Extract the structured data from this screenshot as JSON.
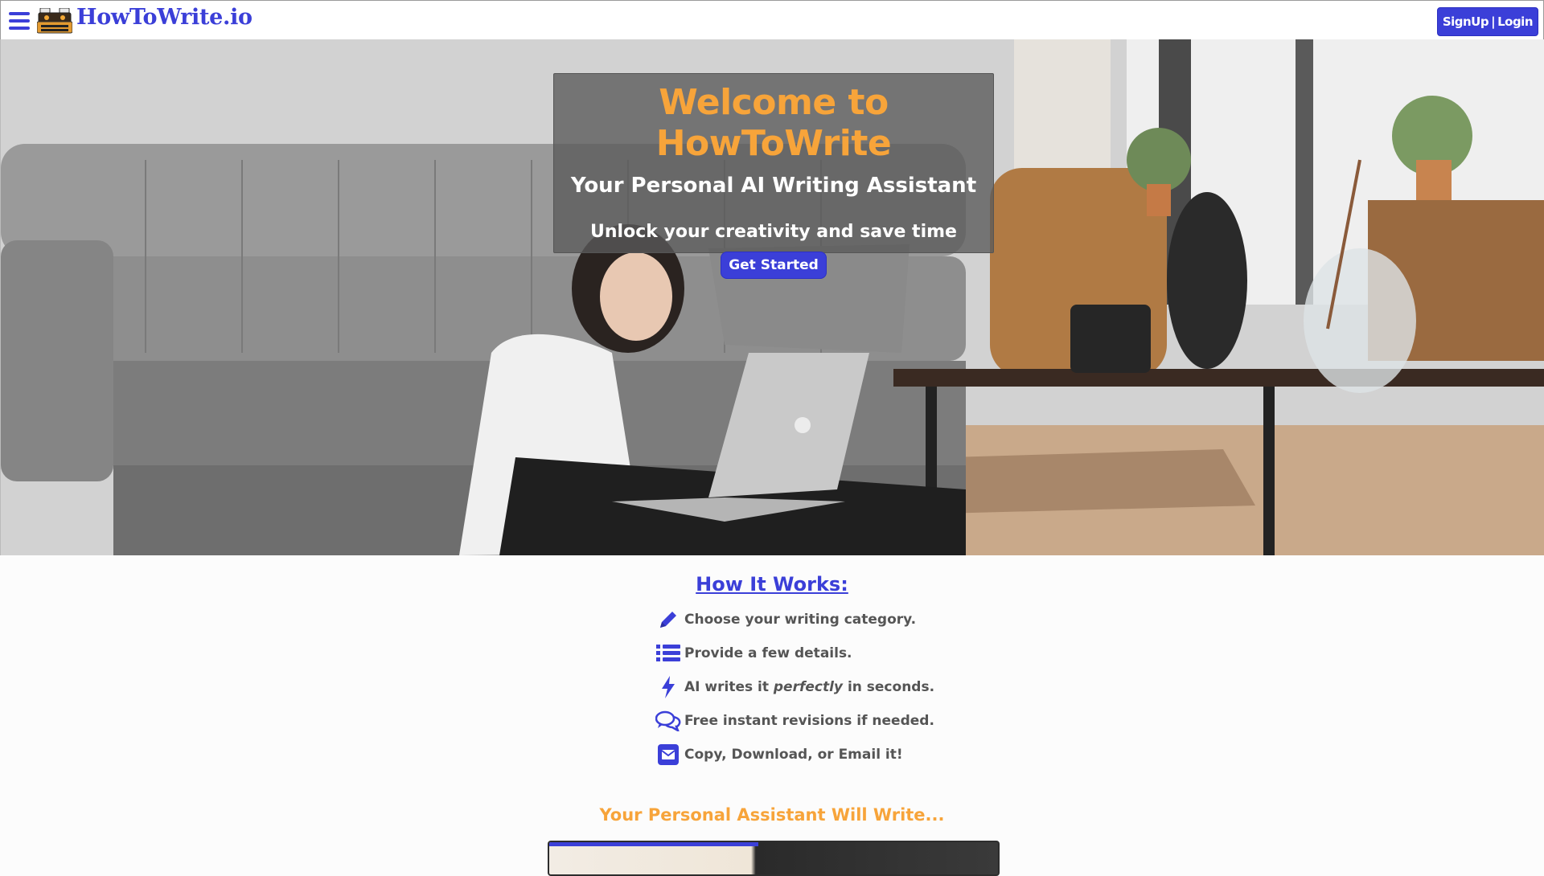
{
  "header": {
    "logo_text": "HowToWrite.io",
    "signup_label": "SignUp",
    "separator": "|",
    "login_label": "Login"
  },
  "hero": {
    "title": "Welcome to HowToWrite",
    "subtitle": "Your Personal AI Writing Assistant",
    "tagline": "Unlock your creativity and save time",
    "cta_label": "Get Started"
  },
  "how_it_works": {
    "title": "How It Works:",
    "steps": [
      {
        "icon": "pencil-icon",
        "text": "Choose your writing category."
      },
      {
        "icon": "list-icon",
        "text": "Provide a few details."
      },
      {
        "icon": "lightning-icon",
        "text_before": "AI writes it",
        "text_em": "perfectly",
        "text_after": "in seconds."
      },
      {
        "icon": "chat-icon",
        "text": "Free instant revisions if needed."
      },
      {
        "icon": "envelope-icon",
        "text": "Copy, Download, or Email it!"
      }
    ]
  },
  "assistant": {
    "title": "Your Personal Assistant Will Write..."
  },
  "colors": {
    "brand": "#3b3fd8",
    "accent": "#f7a43a"
  }
}
